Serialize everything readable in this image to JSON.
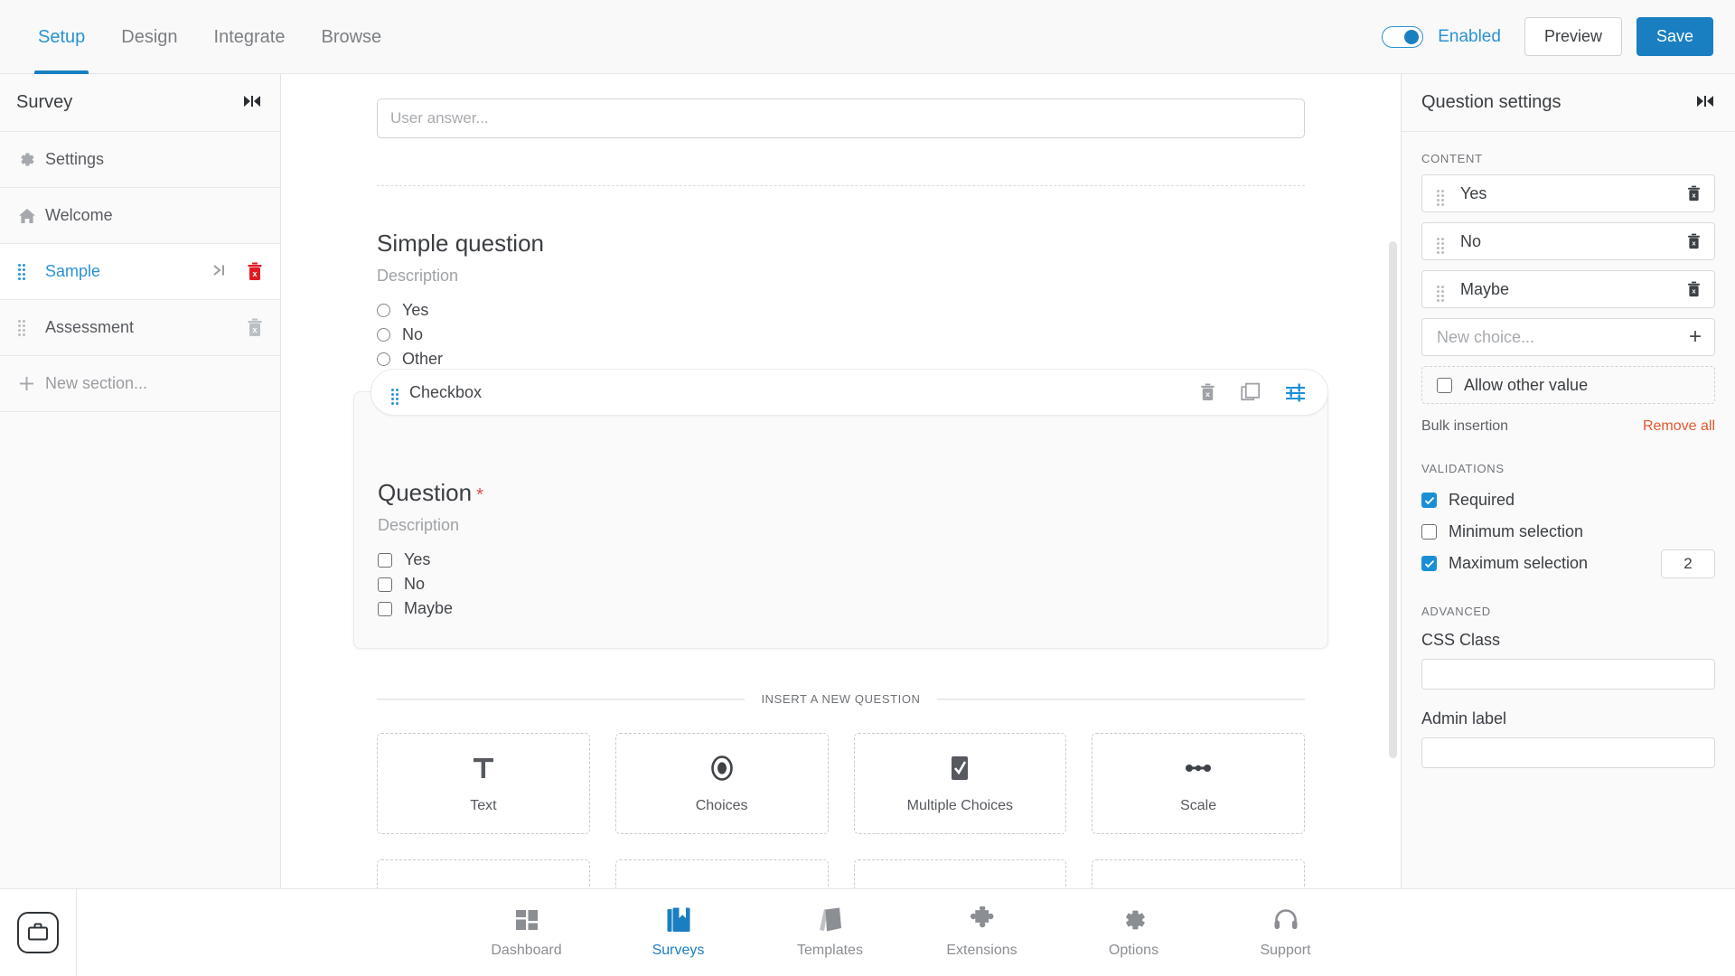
{
  "topbar": {
    "tabs": [
      {
        "label": "Setup",
        "active": true
      },
      {
        "label": "Design",
        "active": false
      },
      {
        "label": "Integrate",
        "active": false
      },
      {
        "label": "Browse",
        "active": false
      }
    ],
    "toggle_label": "Enabled",
    "toggle_state": "on",
    "preview_label": "Preview",
    "save_label": "Save",
    "accent_color": "#1a7fc1"
  },
  "sidebar": {
    "title": "Survey",
    "collapse_icon": "collapse-panel-icon",
    "items": [
      {
        "label": "Settings",
        "icon": "gear-icon"
      },
      {
        "label": "Welcome",
        "icon": "home-icon"
      },
      {
        "label": "Sample",
        "icon": "drag-handle-icon",
        "active": true,
        "has_jump": true,
        "jump_icon": "skip-to-end-icon",
        "delete_icon": "trash-icon-red"
      },
      {
        "label": "Assessment",
        "icon": "drag-handle-icon",
        "delete_icon": "trash-icon-grey"
      },
      {
        "label": "New section...",
        "icon": "plus-icon"
      }
    ]
  },
  "canvas": {
    "answer_placeholder": "User answer...",
    "previous_question": {
      "title": "Simple question",
      "description": "Description",
      "options": [
        "Yes",
        "No",
        "Other"
      ]
    },
    "selected_question": {
      "type_label": "Checkbox",
      "tools": [
        {
          "name": "delete-question-icon"
        },
        {
          "name": "duplicate-question-icon"
        },
        {
          "name": "question-settings-icon",
          "active": true
        }
      ],
      "title": "Question",
      "required_marker": "*",
      "description": "Description",
      "options": [
        "Yes",
        "No",
        "Maybe"
      ]
    },
    "insert_separator_label": "INSERT A NEW QUESTION",
    "question_types": [
      {
        "label": "Text",
        "icon": "text-t-icon"
      },
      {
        "label": "Choices",
        "icon": "radio-filled-icon"
      },
      {
        "label": "Multiple Choices",
        "icon": "checkbox-checked-icon"
      },
      {
        "label": "Scale",
        "icon": "scale-slider-icon"
      },
      {
        "label": "",
        "icon": "matrix-list-icon"
      },
      {
        "label": "",
        "icon": "paragraph-lines-icon"
      },
      {
        "label": "",
        "icon": "number-one-icon"
      },
      {
        "label": "",
        "icon": "calendar-icon"
      }
    ]
  },
  "right_panel": {
    "title": "Question settings",
    "collapse_icon": "collapse-panel-icon",
    "content_section_label": "CONTENT",
    "choices": [
      {
        "label": "Yes",
        "delete_icon": "trash-icon"
      },
      {
        "label": "No",
        "delete_icon": "trash-icon"
      },
      {
        "label": "Maybe",
        "delete_icon": "trash-icon"
      }
    ],
    "new_choice_placeholder": "New choice...",
    "add_choice_icon": "plus-icon",
    "allow_other_value": {
      "label": "Allow other value",
      "checked": false
    },
    "bulk_insertion_label": "Bulk insertion",
    "remove_all_label": "Remove all",
    "remove_all_color": "#e4572e",
    "validations_section_label": "VALIDATIONS",
    "validations": [
      {
        "label": "Required",
        "checked": true
      },
      {
        "label": "Minimum selection",
        "checked": false
      },
      {
        "label": "Maximum selection",
        "checked": true,
        "value": "2"
      }
    ],
    "advanced_section_label": "ADVANCED",
    "css_class_label": "CSS Class",
    "css_class_value": "",
    "admin_label_label": "Admin label",
    "admin_label_value": ""
  },
  "bottombar": {
    "app_icon": "briefcase-icon",
    "items": [
      {
        "label": "Dashboard",
        "icon": "dashboard-grid-icon",
        "active": false
      },
      {
        "label": "Surveys",
        "icon": "book-bookmark-icon",
        "active": true
      },
      {
        "label": "Templates",
        "icon": "templates-cards-icon",
        "active": false
      },
      {
        "label": "Extensions",
        "icon": "puzzle-piece-icon",
        "active": false
      },
      {
        "label": "Options",
        "icon": "gear-icon",
        "active": false
      },
      {
        "label": "Support",
        "icon": "headset-icon",
        "active": false
      }
    ]
  }
}
